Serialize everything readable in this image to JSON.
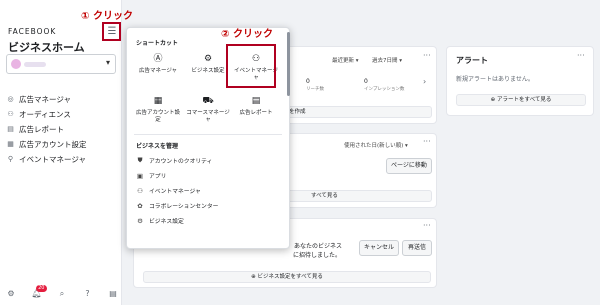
{
  "sidebar": {
    "brand": "FACEBOOK",
    "title": "ビジネスホーム",
    "nav_items": [
      {
        "label": "広告マネージャ",
        "icon": "target-icon",
        "glyph": "◎"
      },
      {
        "label": "オーディエンス",
        "icon": "people-icon",
        "glyph": "⚇"
      },
      {
        "label": "広告レポート",
        "icon": "report-icon",
        "glyph": "▤"
      },
      {
        "label": "広告アカウント設定",
        "icon": "settings-folder-icon",
        "glyph": "▦"
      },
      {
        "label": "イベントマネージャ",
        "icon": "events-icon",
        "glyph": "⚲"
      }
    ],
    "footer_badge": "20"
  },
  "menu": {
    "shortcuts_heading": "ショートカット",
    "shortcuts": [
      {
        "label": "広告マネージャ",
        "glyph": "Ⓐ",
        "icon": "ads-manager-icon"
      },
      {
        "label": "ビジネス設定",
        "glyph": "⚙",
        "icon": "gear-icon"
      },
      {
        "label": "イベントマネージャ",
        "glyph": "⚇",
        "icon": "events-manager-icon"
      },
      {
        "label": "広告アカウント設定",
        "glyph": "▦",
        "icon": "ad-account-icon"
      },
      {
        "label": "コマースマネージャ",
        "glyph": "⛟",
        "icon": "cart-icon"
      },
      {
        "label": "広告レポート",
        "glyph": "▤",
        "icon": "report-icon"
      }
    ],
    "manage_heading": "ビジネスを管理",
    "manage_items": [
      {
        "label": "アカウントのクオリティ",
        "glyph": "⛊",
        "icon": "shield-icon"
      },
      {
        "label": "アプリ",
        "glyph": "▣",
        "icon": "app-icon"
      },
      {
        "label": "イベントマネージャ",
        "glyph": "⚇",
        "icon": "events-icon"
      },
      {
        "label": "コラボレーションセンター",
        "glyph": "✿",
        "icon": "collab-icon"
      },
      {
        "label": "ビジネス設定",
        "glyph": "⚙",
        "icon": "gear-icon"
      }
    ]
  },
  "perf_card": {
    "recent_updates": "最近更新",
    "range": "過去7日間",
    "stat1_value": "0",
    "stat1_label": "リーチ数",
    "stat2_value": "0",
    "stat2_label": "インプレッション数",
    "create_button": "を作成"
  },
  "biz_card": {
    "usage_filter": "使用された日(新しい順)",
    "go_button": "ページに移動",
    "see_all": "すべて見る"
  },
  "invite_card": {
    "text_right": "あなたのビジネス",
    "text_left": "に招待しました。",
    "cancel": "キャンセル",
    "resend": "再送信",
    "see_all_settings": "ビジネス設定をすべて見る"
  },
  "alerts": {
    "title": "アラート",
    "empty_text": "新規アラートはありません。",
    "see_all": "アラートをすべて見る"
  },
  "annotations": {
    "step1": "① クリック",
    "step2": "② クリック",
    "color": "#c00000"
  }
}
